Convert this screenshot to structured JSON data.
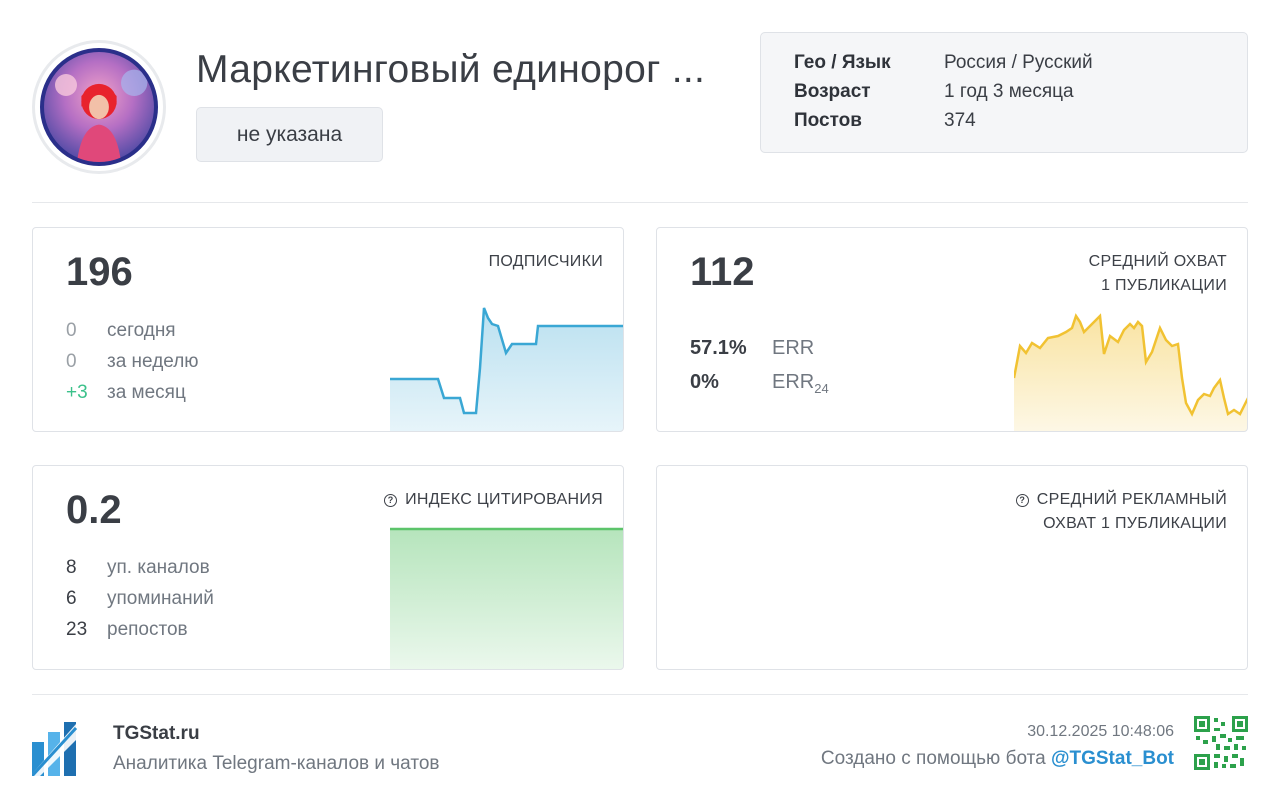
{
  "header": {
    "title": "Маркетинговый единорог ...",
    "category": "не указана",
    "info": [
      {
        "key": "Гео / Язык",
        "value": "Россия / Русский"
      },
      {
        "key": "Возраст",
        "value": "1 год 3 месяца"
      },
      {
        "key": "Постов",
        "value": "374"
      }
    ]
  },
  "subscribers": {
    "label": "ПОДПИСЧИКИ",
    "value": "196",
    "rows": [
      {
        "num": "0",
        "text": "сегодня"
      },
      {
        "num": "0",
        "text": "за неделю"
      },
      {
        "num": "+3",
        "text": "за месяц"
      }
    ],
    "color": "#3aa7d4"
  },
  "reach": {
    "label_line1": "СРЕДНИЙ ОХВАТ",
    "label_line2": "1 ПУБЛИКАЦИИ",
    "value": "112",
    "err": {
      "num": "57.1%",
      "text": "ERR"
    },
    "err24": {
      "num": "0%",
      "text": "ERR",
      "sub": "24"
    },
    "color": "#f1c232"
  },
  "citation": {
    "label": "ИНДЕКС ЦИТИРОВАНИЯ",
    "value": "0.2",
    "rows": [
      {
        "num": "8",
        "text": "уп. каналов"
      },
      {
        "num": "6",
        "text": "упоминаний"
      },
      {
        "num": "23",
        "text": "репостов"
      }
    ],
    "color": "#5cc46a"
  },
  "ad_reach": {
    "label_line1": "СРЕДНИЙ РЕКЛАМНЫЙ",
    "label_line2": "ОХВАТ 1 ПУБЛИКАЦИИ"
  },
  "footer": {
    "brand": "TGStat.ru",
    "tagline": "Аналитика Telegram-каналов и чатов",
    "timestamp": "30.12.2025 10:48:06",
    "created_prefix": "Создано с помощью бота ",
    "bot": "@TGStat_Bot"
  }
}
